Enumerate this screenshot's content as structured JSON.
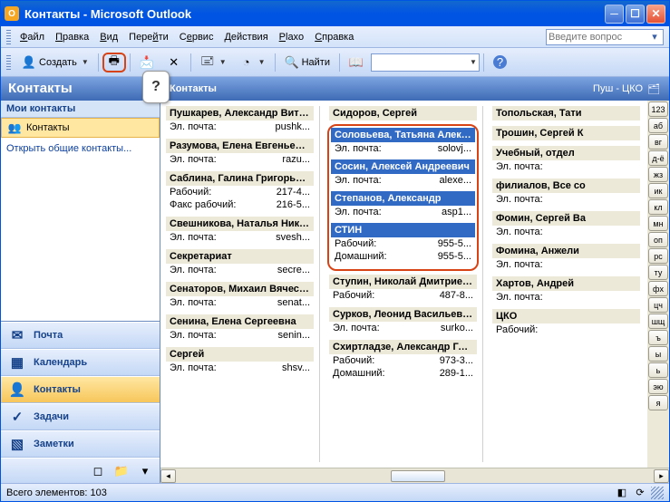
{
  "window": {
    "title": "Контакты - Microsoft Outlook"
  },
  "menu": [
    "Файл",
    "Правка",
    "Вид",
    "Перейти",
    "Сервис",
    "Действия",
    "Plaxo",
    "Справка"
  ],
  "help_placeholder": "Введите вопрос",
  "callout": "?",
  "toolbar": {
    "create": "Создать",
    "find": "Найти"
  },
  "nav": {
    "header": "Контакты",
    "section": "Мои контакты",
    "item": "Контакты",
    "link": "Открыть общие контакты...",
    "wunderbar": [
      {
        "label": "Почта",
        "icon": "✉",
        "sel": false
      },
      {
        "label": "Календарь",
        "icon": "▦",
        "sel": false
      },
      {
        "label": "Контакты",
        "icon": "👤",
        "sel": true
      },
      {
        "label": "Задачи",
        "icon": "✓",
        "sel": false
      },
      {
        "label": "Заметки",
        "icon": "▧",
        "sel": false
      }
    ]
  },
  "main": {
    "header": "Контакты",
    "range": "Пуш - ЦКО"
  },
  "columns": [
    [
      {
        "name": "Пушкарев, Александр Вита...",
        "rows": [
          [
            "Эл. почта:",
            "pushk..."
          ]
        ]
      },
      {
        "name": "Разумова, Елена Евгеньевна",
        "rows": [
          [
            "Эл. почта:",
            "razu..."
          ]
        ]
      },
      {
        "name": "Саблина, Галина Григорьевна",
        "rows": [
          [
            "Рабочий:",
            "217-4..."
          ],
          [
            "Факс рабочий:",
            "216-5..."
          ]
        ]
      },
      {
        "name": "Свешникова, Наталья Никол...",
        "rows": [
          [
            "Эл. почта:",
            "svesh..."
          ]
        ]
      },
      {
        "name": "Секретариат",
        "rows": [
          [
            "Эл. почта:",
            "secre..."
          ]
        ]
      },
      {
        "name": "Сенаторов, Михаил Вячесла...",
        "rows": [
          [
            "Эл. почта:",
            "senat..."
          ]
        ]
      },
      {
        "name": "Сенина, Елена Сергеевна",
        "rows": [
          [
            "Эл. почта:",
            "senin..."
          ]
        ]
      },
      {
        "name": "Сергей",
        "rows": [
          [
            "Эл. почта:",
            "shsv..."
          ]
        ]
      }
    ],
    [
      {
        "name": "Сидоров, Сергей",
        "rows": []
      },
      {
        "name": "Соловьева, Татьяна Алекса...",
        "sel": true,
        "rows": [
          [
            "Эл. почта:",
            "solovj..."
          ]
        ],
        "boxed": "start"
      },
      {
        "name": "Сосин, Алексей Андреевич",
        "sel": true,
        "rows": [
          [
            "Эл. почта:",
            "alexe..."
          ]
        ],
        "boxed": "mid"
      },
      {
        "name": "Степанов, Александр",
        "sel": true,
        "rows": [
          [
            "Эл. почта:",
            "asp1..."
          ]
        ],
        "boxed": "mid"
      },
      {
        "name": "СТИН",
        "sel": true,
        "rows": [
          [
            "Рабочий:",
            "955-5..."
          ],
          [
            "Домашний:",
            "955-5..."
          ]
        ],
        "boxed": "end"
      },
      {
        "name": "Ступин, Николай Дмитриевич",
        "rows": [
          [
            "Рабочий:",
            "487-8..."
          ]
        ]
      },
      {
        "name": "Сурков, Леонид Васильевич",
        "rows": [
          [
            "Эл. почта:",
            "surko..."
          ]
        ]
      },
      {
        "name": "Схиртладзе, Александр Гео...",
        "rows": [
          [
            "Рабочий:",
            "973-3..."
          ],
          [
            "Домашний:",
            "289-1..."
          ]
        ]
      }
    ],
    [
      {
        "name": "Топольская, Тати",
        "rows": []
      },
      {
        "name": "Трошин, Сергей К",
        "rows": []
      },
      {
        "name": "Учебный, отдел",
        "rows": [
          [
            "Эл. почта:",
            ""
          ]
        ]
      },
      {
        "name": "филиалов, Все со",
        "rows": [
          [
            "Эл. почта:",
            ""
          ]
        ]
      },
      {
        "name": "Фомин, Сергей Ва",
        "rows": [
          [
            "Эл. почта:",
            ""
          ]
        ]
      },
      {
        "name": "Фомина, Анжели",
        "rows": [
          [
            "Эл. почта:",
            ""
          ]
        ]
      },
      {
        "name": "Хартов, Андрей",
        "rows": [
          [
            "Эл. почта:",
            ""
          ]
        ]
      },
      {
        "name": "ЦКО",
        "rows": [
          [
            "Рабочий:",
            ""
          ]
        ]
      }
    ]
  ],
  "index": [
    "123",
    "аб",
    "вг",
    "д-ё",
    "жз",
    "ик",
    "кл",
    "мн",
    "оп",
    "рс",
    "ту",
    "фх",
    "цч",
    "шщ",
    "ъ",
    "ы",
    "ь",
    "эю",
    "я"
  ],
  "status": {
    "text": "Всего элементов: 103"
  }
}
